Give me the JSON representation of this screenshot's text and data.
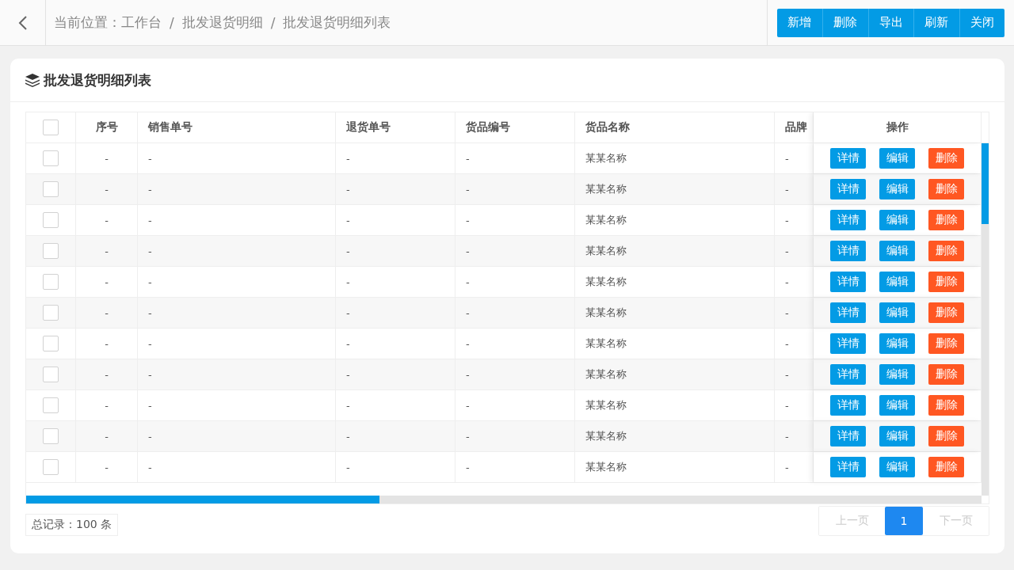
{
  "breadcrumb": {
    "label": "当前位置：",
    "items": [
      "工作台",
      "批发退货明细",
      "批发退货明细列表"
    ],
    "separator": "/"
  },
  "toolbar": [
    "新增",
    "删除",
    "导出",
    "刷新",
    "关闭"
  ],
  "panel": {
    "title": "批发退货明细列表"
  },
  "table": {
    "columns": [
      "序号",
      "销售单号",
      "退货单号",
      "货品编号",
      "货品名称",
      "品牌",
      "操作"
    ],
    "all_checked": false,
    "rows": [
      {
        "checked": false,
        "cells": [
          "-",
          "-",
          "-",
          "-",
          "某某名称",
          "-"
        ],
        "actions": [
          {
            "label": "详情",
            "kind": "info"
          },
          {
            "label": "编辑",
            "kind": "info"
          },
          {
            "label": "删除",
            "kind": "danger"
          }
        ]
      },
      {
        "checked": false,
        "cells": [
          "-",
          "-",
          "-",
          "-",
          "某某名称",
          "-"
        ],
        "actions": [
          {
            "label": "详情",
            "kind": "info"
          },
          {
            "label": "编辑",
            "kind": "info"
          },
          {
            "label": "删除",
            "kind": "danger"
          }
        ]
      },
      {
        "checked": false,
        "cells": [
          "-",
          "-",
          "-",
          "-",
          "某某名称",
          "-"
        ],
        "actions": [
          {
            "label": "详情",
            "kind": "info"
          },
          {
            "label": "编辑",
            "kind": "info"
          },
          {
            "label": "删除",
            "kind": "danger"
          }
        ]
      },
      {
        "checked": false,
        "cells": [
          "-",
          "-",
          "-",
          "-",
          "某某名称",
          "-"
        ],
        "actions": [
          {
            "label": "详情",
            "kind": "info"
          },
          {
            "label": "编辑",
            "kind": "info"
          },
          {
            "label": "删除",
            "kind": "danger"
          }
        ]
      },
      {
        "checked": false,
        "cells": [
          "-",
          "-",
          "-",
          "-",
          "某某名称",
          "-"
        ],
        "actions": [
          {
            "label": "详情",
            "kind": "info"
          },
          {
            "label": "编辑",
            "kind": "info"
          },
          {
            "label": "删除",
            "kind": "danger"
          }
        ]
      },
      {
        "checked": false,
        "cells": [
          "-",
          "-",
          "-",
          "-",
          "某某名称",
          "-"
        ],
        "actions": [
          {
            "label": "详情",
            "kind": "info"
          },
          {
            "label": "编辑",
            "kind": "info"
          },
          {
            "label": "删除",
            "kind": "danger"
          }
        ]
      },
      {
        "checked": false,
        "cells": [
          "-",
          "-",
          "-",
          "-",
          "某某名称",
          "-"
        ],
        "actions": [
          {
            "label": "详情",
            "kind": "info"
          },
          {
            "label": "编辑",
            "kind": "info"
          },
          {
            "label": "删除",
            "kind": "danger"
          }
        ]
      },
      {
        "checked": false,
        "cells": [
          "-",
          "-",
          "-",
          "-",
          "某某名称",
          "-"
        ],
        "actions": [
          {
            "label": "详情",
            "kind": "info"
          },
          {
            "label": "编辑",
            "kind": "info"
          },
          {
            "label": "删除",
            "kind": "danger"
          }
        ]
      },
      {
        "checked": false,
        "cells": [
          "-",
          "-",
          "-",
          "-",
          "某某名称",
          "-"
        ],
        "actions": [
          {
            "label": "详情",
            "kind": "info"
          },
          {
            "label": "编辑",
            "kind": "info"
          },
          {
            "label": "删除",
            "kind": "danger"
          }
        ]
      },
      {
        "checked": false,
        "cells": [
          "-",
          "-",
          "-",
          "-",
          "某某名称",
          "-"
        ],
        "actions": [
          {
            "label": "详情",
            "kind": "info"
          },
          {
            "label": "编辑",
            "kind": "info"
          },
          {
            "label": "删除",
            "kind": "danger"
          }
        ]
      },
      {
        "checked": false,
        "cells": [
          "-",
          "-",
          "-",
          "-",
          "某某名称",
          "-"
        ],
        "actions": [
          {
            "label": "详情",
            "kind": "info"
          },
          {
            "label": "编辑",
            "kind": "info"
          },
          {
            "label": "删除",
            "kind": "danger"
          }
        ]
      }
    ]
  },
  "total": "总记录：100 条",
  "pagination": [
    {
      "label": "上一页",
      "kind": "prev",
      "disabled": true,
      "selected": false
    },
    {
      "label": "1",
      "kind": "page",
      "disabled": false,
      "selected": true
    },
    {
      "label": "下一页",
      "kind": "next",
      "disabled": true,
      "selected": false
    }
  ]
}
